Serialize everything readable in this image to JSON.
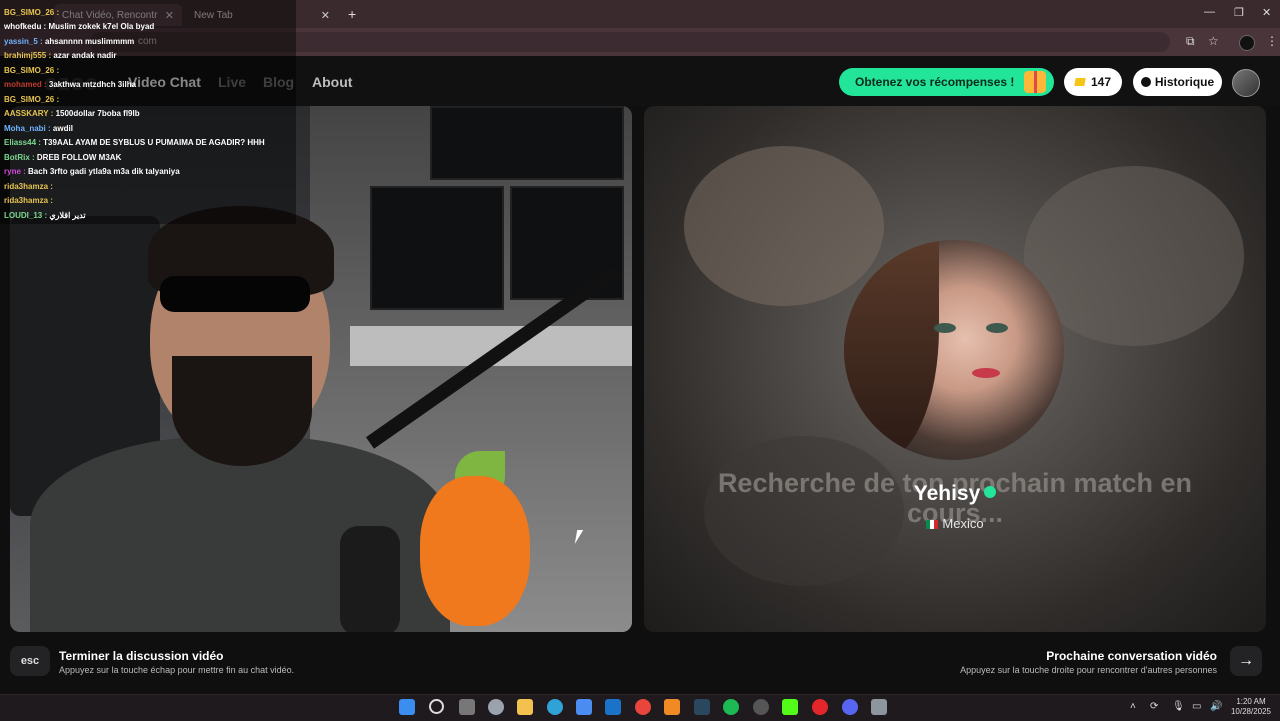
{
  "browser": {
    "tabs": [
      {
        "label": "Chat Vidéo, Rencontr"
      },
      {
        "label": "New Tab"
      }
    ],
    "url": "com"
  },
  "site": {
    "nav": {
      "video_chat": "Video Chat",
      "live": "Live",
      "blog": "Blog",
      "about": "About"
    },
    "rewards_label": "Obtenez vos récompenses !",
    "coins": "147",
    "history_label": "Historique"
  },
  "match": {
    "searching_text": "Recherche de ton prochain match en cours...",
    "name": "Yehisy",
    "country": "Mexico"
  },
  "chat": [
    {
      "user": "BG_SIMO_26 :",
      "msg": "",
      "color": "#e7c451"
    },
    {
      "user": "whofkedu :",
      "msg": "Muslim zokek k7el Ola byad",
      "color": "#ffffff"
    },
    {
      "user": "yassin_5 :",
      "msg": "ahsannnn muslimmmm",
      "color": "#6fb3ff"
    },
    {
      "user": "brahimj555 :",
      "msg": "azar andak nadir",
      "color": "#e7c451"
    },
    {
      "user": "BG_SIMO_26 :",
      "msg": "",
      "color": "#e7c451"
    },
    {
      "user": "mohamed :",
      "msg": "3akthwa mtzdhch 3ilha",
      "color": "#c0392b"
    },
    {
      "user": "BG_SIMO_26 :",
      "msg": "",
      "color": "#e7c451"
    },
    {
      "user": "AASSKARY :",
      "msg": "1500dollar 7boba fl9lb",
      "color": "#e7c451"
    },
    {
      "user": "Moha_nabi :",
      "msg": "awdil",
      "color": "#6fb3ff"
    },
    {
      "user": "Eliass44 :",
      "msg": "T39AAL AYAM DE SYBLUS U PUMAIMA DE AGADIR? HHH",
      "color": "#7bd88f"
    },
    {
      "user": "BotRix :",
      "msg": "DREB FOLLOW M3AK",
      "color": "#7bd88f"
    },
    {
      "user": "ryne :",
      "msg": "Bach 3rfto gadi ytla9a m3a dik talyaniya",
      "color": "#d04ad9"
    },
    {
      "user": "rida3hamza :",
      "msg": "",
      "color": "#e7c451"
    },
    {
      "user": "rida3hamza :",
      "msg": "",
      "color": "#e7c451"
    },
    {
      "user": "LOUDI_13 :",
      "msg": "تدير اقلاري",
      "color": "#7bd88f"
    }
  ],
  "bottom": {
    "esc_label": "esc",
    "end_title": "Terminer la discussion vidéo",
    "end_sub": "Appuyez sur la touche échap pour mettre fin au chat vidéo.",
    "next_title": "Prochaine conversation vidéo",
    "next_sub": "Appuyez sur la touche droite pour rencontrer d'autres personnes",
    "next_arrow": "→"
  },
  "taskbar": {
    "time": "1:20 AM",
    "date": "10/28/2025"
  },
  "colors": {
    "accent": "#23e59a",
    "bg": "#0f0f10"
  }
}
